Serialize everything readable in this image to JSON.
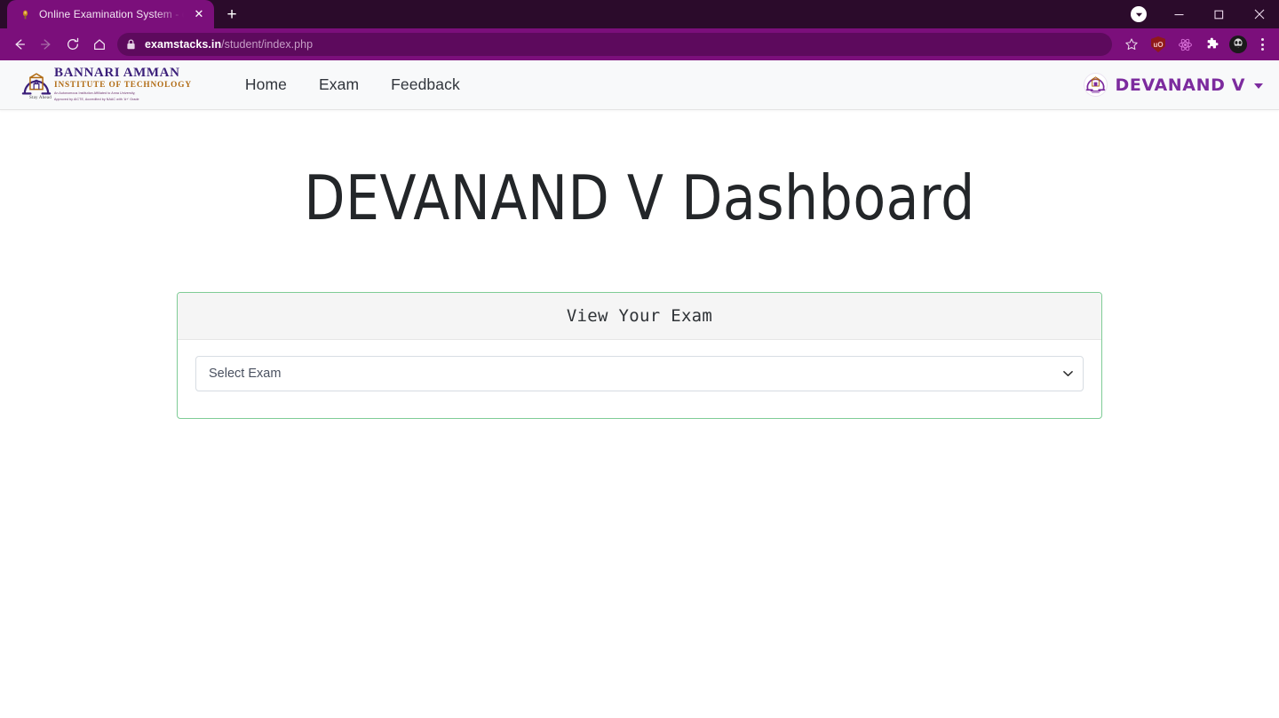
{
  "browser": {
    "tab": {
      "title": "Online Examination System - dat",
      "favicon_icon": "page-favicon-icon",
      "close_label": "✕"
    },
    "new_tab_label": "+",
    "window_controls": {
      "tab_search_icon": "tab-search-icon",
      "minimize_label": "—",
      "maximize_label": "❐",
      "close_label": "✕"
    },
    "toolbar": {
      "back_icon": "back-arrow-icon",
      "forward_icon": "forward-arrow-icon",
      "reload_icon": "reload-icon",
      "home_icon": "home-icon",
      "lock_icon": "lock-icon",
      "url_domain": "examstacks.in",
      "url_path": "/student/index.php",
      "bookmark_icon": "star-icon",
      "ublock_icon": "ublock-origin-icon",
      "ublock_label": "uO",
      "react_icon": "react-devtools-icon",
      "extensions_icon": "puzzle-piece-icon",
      "profile_icon": "profile-avatar-icon",
      "menu_icon": "three-dots-menu-icon"
    }
  },
  "site": {
    "navbar": {
      "logo": {
        "line1": "BANNARI AMMAN",
        "line2": "INSTITUTE OF TECHNOLOGY",
        "line3": "An Autonomous Institution Affiliated to Anna University,",
        "line4": "Approved by AICTE, Accredited by NAAC with 'A+' Grade",
        "tagline": "Stay Ahead"
      },
      "links": [
        {
          "label": "Home"
        },
        {
          "label": "Exam"
        },
        {
          "label": "Feedback"
        }
      ],
      "user": {
        "name": "DEVANAND V",
        "avatar_icon": "user-avatar-icon",
        "caret_icon": "chevron-down-icon"
      }
    },
    "main": {
      "page_title": "DEVANAND V Dashboard",
      "card": {
        "header_title": "View Your Exam",
        "select": {
          "value": "Select Exam",
          "arrow_icon": "chevron-down-icon",
          "options": [
            "Select Exam"
          ]
        }
      }
    }
  },
  "colors": {
    "chrome_accent": "#7b0f7b",
    "chrome_dark": "#2b0b2b",
    "card_border_green": "#7fcc96",
    "brand_purple": "#7c2b9e",
    "navbar_bg": "#f8f9fa"
  }
}
